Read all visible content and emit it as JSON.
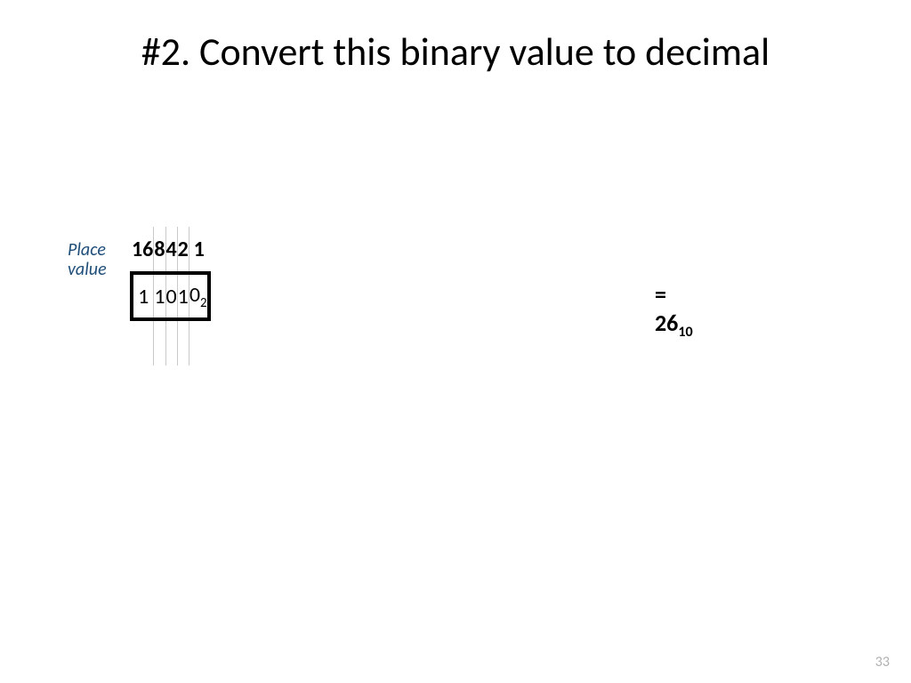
{
  "title": "#2. Convert this binary value to decimal",
  "place_label_line1": "Place",
  "place_label_line2": "value",
  "headers": [
    "16",
    "8",
    "4",
    "2",
    "1"
  ],
  "binary": [
    "1",
    "1",
    "0",
    "1",
    "0"
  ],
  "binary_base_sub": "2",
  "result_prefix": "= 26",
  "result_sub": "10",
  "page_number": "33"
}
